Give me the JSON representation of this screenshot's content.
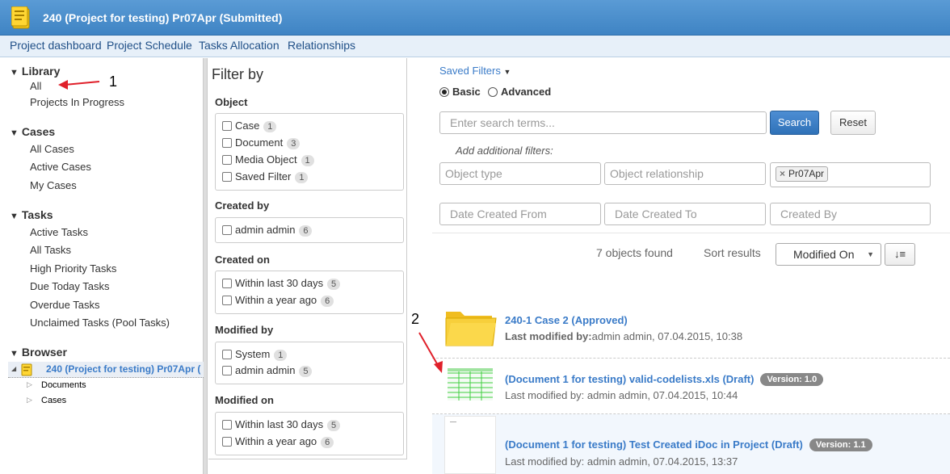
{
  "header": {
    "title": "240 (Project for testing) Pr07Apr (Submitted)",
    "project_icon": "project-document-icon"
  },
  "nav": {
    "items": [
      "Project dashboard",
      "Project Schedule",
      "Tasks Allocation",
      "Relationships"
    ]
  },
  "sidebar": {
    "library": {
      "title": "Library",
      "items": [
        "All",
        "Projects In Progress"
      ]
    },
    "cases": {
      "title": "Cases",
      "items": [
        "All Cases",
        "Active Cases",
        "My Cases"
      ]
    },
    "tasks": {
      "title": "Tasks",
      "items": [
        "Active Tasks",
        "All Tasks",
        "High Priority Tasks",
        "Due Today Tasks",
        "Overdue Tasks",
        "Unclaimed Tasks (Pool Tasks)"
      ]
    },
    "browser": {
      "title": "Browser",
      "root": "240 (Project for testing) Pr07Apr (",
      "children": [
        "Documents",
        "Cases"
      ]
    }
  },
  "annotations": {
    "one": "1",
    "two": "2"
  },
  "filter": {
    "title": "Filter by",
    "object": {
      "label": "Object",
      "items": [
        {
          "name": "Case",
          "count": "1"
        },
        {
          "name": "Document",
          "count": "3"
        },
        {
          "name": "Media Object",
          "count": "1"
        },
        {
          "name": "Saved Filter",
          "count": "1"
        }
      ]
    },
    "created_by": {
      "label": "Created by",
      "items": [
        {
          "name": "admin admin",
          "count": "6"
        }
      ]
    },
    "created_on": {
      "label": "Created on",
      "items": [
        {
          "name": "Within last 30 days",
          "count": "5"
        },
        {
          "name": "Within a year ago",
          "count": "6"
        }
      ]
    },
    "modified_by": {
      "label": "Modified by",
      "items": [
        {
          "name": "System",
          "count": "1"
        },
        {
          "name": "admin admin",
          "count": "5"
        }
      ]
    },
    "modified_on": {
      "label": "Modified on",
      "items": [
        {
          "name": "Within last 30 days",
          "count": "5"
        },
        {
          "name": "Within a year ago",
          "count": "6"
        }
      ]
    }
  },
  "search": {
    "saved_filters": "Saved Filters",
    "mode_basic": "Basic",
    "mode_advanced": "Advanced",
    "placeholder": "Enter search terms...",
    "search_button": "Search",
    "reset_button": "Reset",
    "add_filters": "Add additional filters:",
    "object_type_placeholder": "Object type",
    "object_relationship_placeholder": "Object relationship",
    "context_tag": "Pr07Apr",
    "date_from_placeholder": "Date Created From",
    "date_to_placeholder": "Date Created To",
    "created_by_placeholder": "Created By"
  },
  "results_bar": {
    "found": "7 objects found",
    "sort_label": "Sort results",
    "sort_value": "Modified On"
  },
  "results": [
    {
      "title": "240-1 Case 2 (Approved)",
      "meta_label": "Last modified by:",
      "meta_value": "admin admin, 07.04.2015, 10:38",
      "icon": "folder-icon"
    },
    {
      "title": "(Document 1 for testing) valid-codelists.xls (Draft)",
      "version": "Version: 1.0",
      "meta": "Last modified by: admin admin, 07.04.2015, 10:44",
      "icon": "spreadsheet-thumbnail-icon"
    },
    {
      "title": "(Document 1 for testing) Test Created iDoc in Project (Draft)",
      "version": "Version: 1.1",
      "meta": "Last modified by: admin admin, 07.04.2015, 13:37",
      "icon": "document-thumbnail-icon"
    }
  ],
  "colors": {
    "header": "#3f84c4",
    "link": "#3a7bc8",
    "annotation_arrow": "#e0202a"
  }
}
